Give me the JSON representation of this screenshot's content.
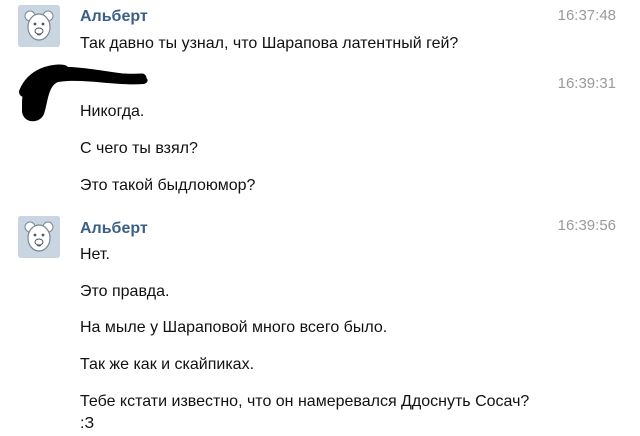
{
  "messages": [
    {
      "author": "Альберт",
      "time": "16:37:48",
      "avatar_icon": "teddy-bear-avatar-icon",
      "lines": [
        "Так давно ты узнал, что Шарапова латентный гей?"
      ]
    },
    {
      "author": "",
      "time": "16:39:31",
      "avatar_icon": "redacted-scribble-avatar",
      "lines": [
        "Никогда.",
        "С чего ты взял?",
        "Это такой быдлоюмор?"
      ]
    },
    {
      "author": "Альберт",
      "time": "16:39:56",
      "avatar_icon": "teddy-bear-avatar-icon",
      "lines": [
        "Нет.",
        "Это правда.",
        "На мыле у Шараповой много всего было.",
        "Так же как и скайпиках.",
        "Тебе кстати известно, что он намеревался Ддоснуть Сосач?",
        ":З"
      ]
    }
  ],
  "colors": {
    "author_name": "#3b5f85",
    "timestamp": "#9a9a9a",
    "avatar_bg": "#c9d5e0"
  }
}
